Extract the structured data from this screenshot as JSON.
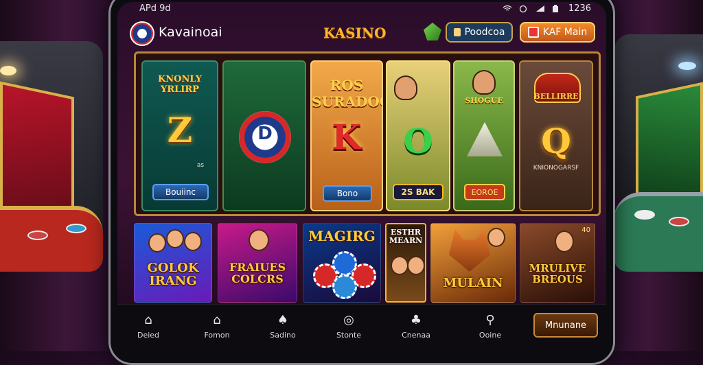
{
  "status_bar": {
    "time": "APd 9d",
    "clock": "1236"
  },
  "header": {
    "brand": "Kavainoai",
    "title": "KASINO",
    "deposit_label": "Poodcoa",
    "vip_label": "KAF Main"
  },
  "featured": {
    "reels": [
      {
        "title": "KNONLY YRLIRP",
        "symbol": "Z",
        "sub": "as",
        "button": "Bouiinc"
      },
      {
        "symbol": "D"
      },
      {
        "title": "ROS SURADOOONS",
        "symbol": "K",
        "button": "Bono"
      },
      {
        "symbol": "O",
        "button": "2S BAK"
      },
      {
        "title": "SHOGUE",
        "button": "EOROE"
      },
      {
        "title": "BELLIRRE",
        "symbol": "Q",
        "sub": "KNIONOGARSF"
      }
    ]
  },
  "tiles": [
    {
      "label": "GOLOK IRANG"
    },
    {
      "label": "FRAIUES COLCRS"
    },
    {
      "label": "MAGIRG"
    },
    {
      "label": "ESTHR MEARN"
    },
    {
      "label": "MULAIN"
    },
    {
      "label": "MRULIVE BREOUS",
      "badge": "40"
    }
  ],
  "bottom_nav": {
    "items": [
      {
        "label": "Deied",
        "icon": "home-icon"
      },
      {
        "label": "Fomon",
        "icon": "house-icon"
      },
      {
        "label": "Sadino",
        "icon": "cards-icon"
      },
      {
        "label": "Stonte",
        "icon": "chip-icon"
      },
      {
        "label": "Cnenaa",
        "icon": "casino-icon"
      },
      {
        "label": "Ooine",
        "icon": "search-icon"
      }
    ],
    "cta_label": "Mnunane"
  },
  "colors": {
    "accent": "#ffb627",
    "brand_blue": "#1e3a8a",
    "cta": "#c98a3a"
  }
}
